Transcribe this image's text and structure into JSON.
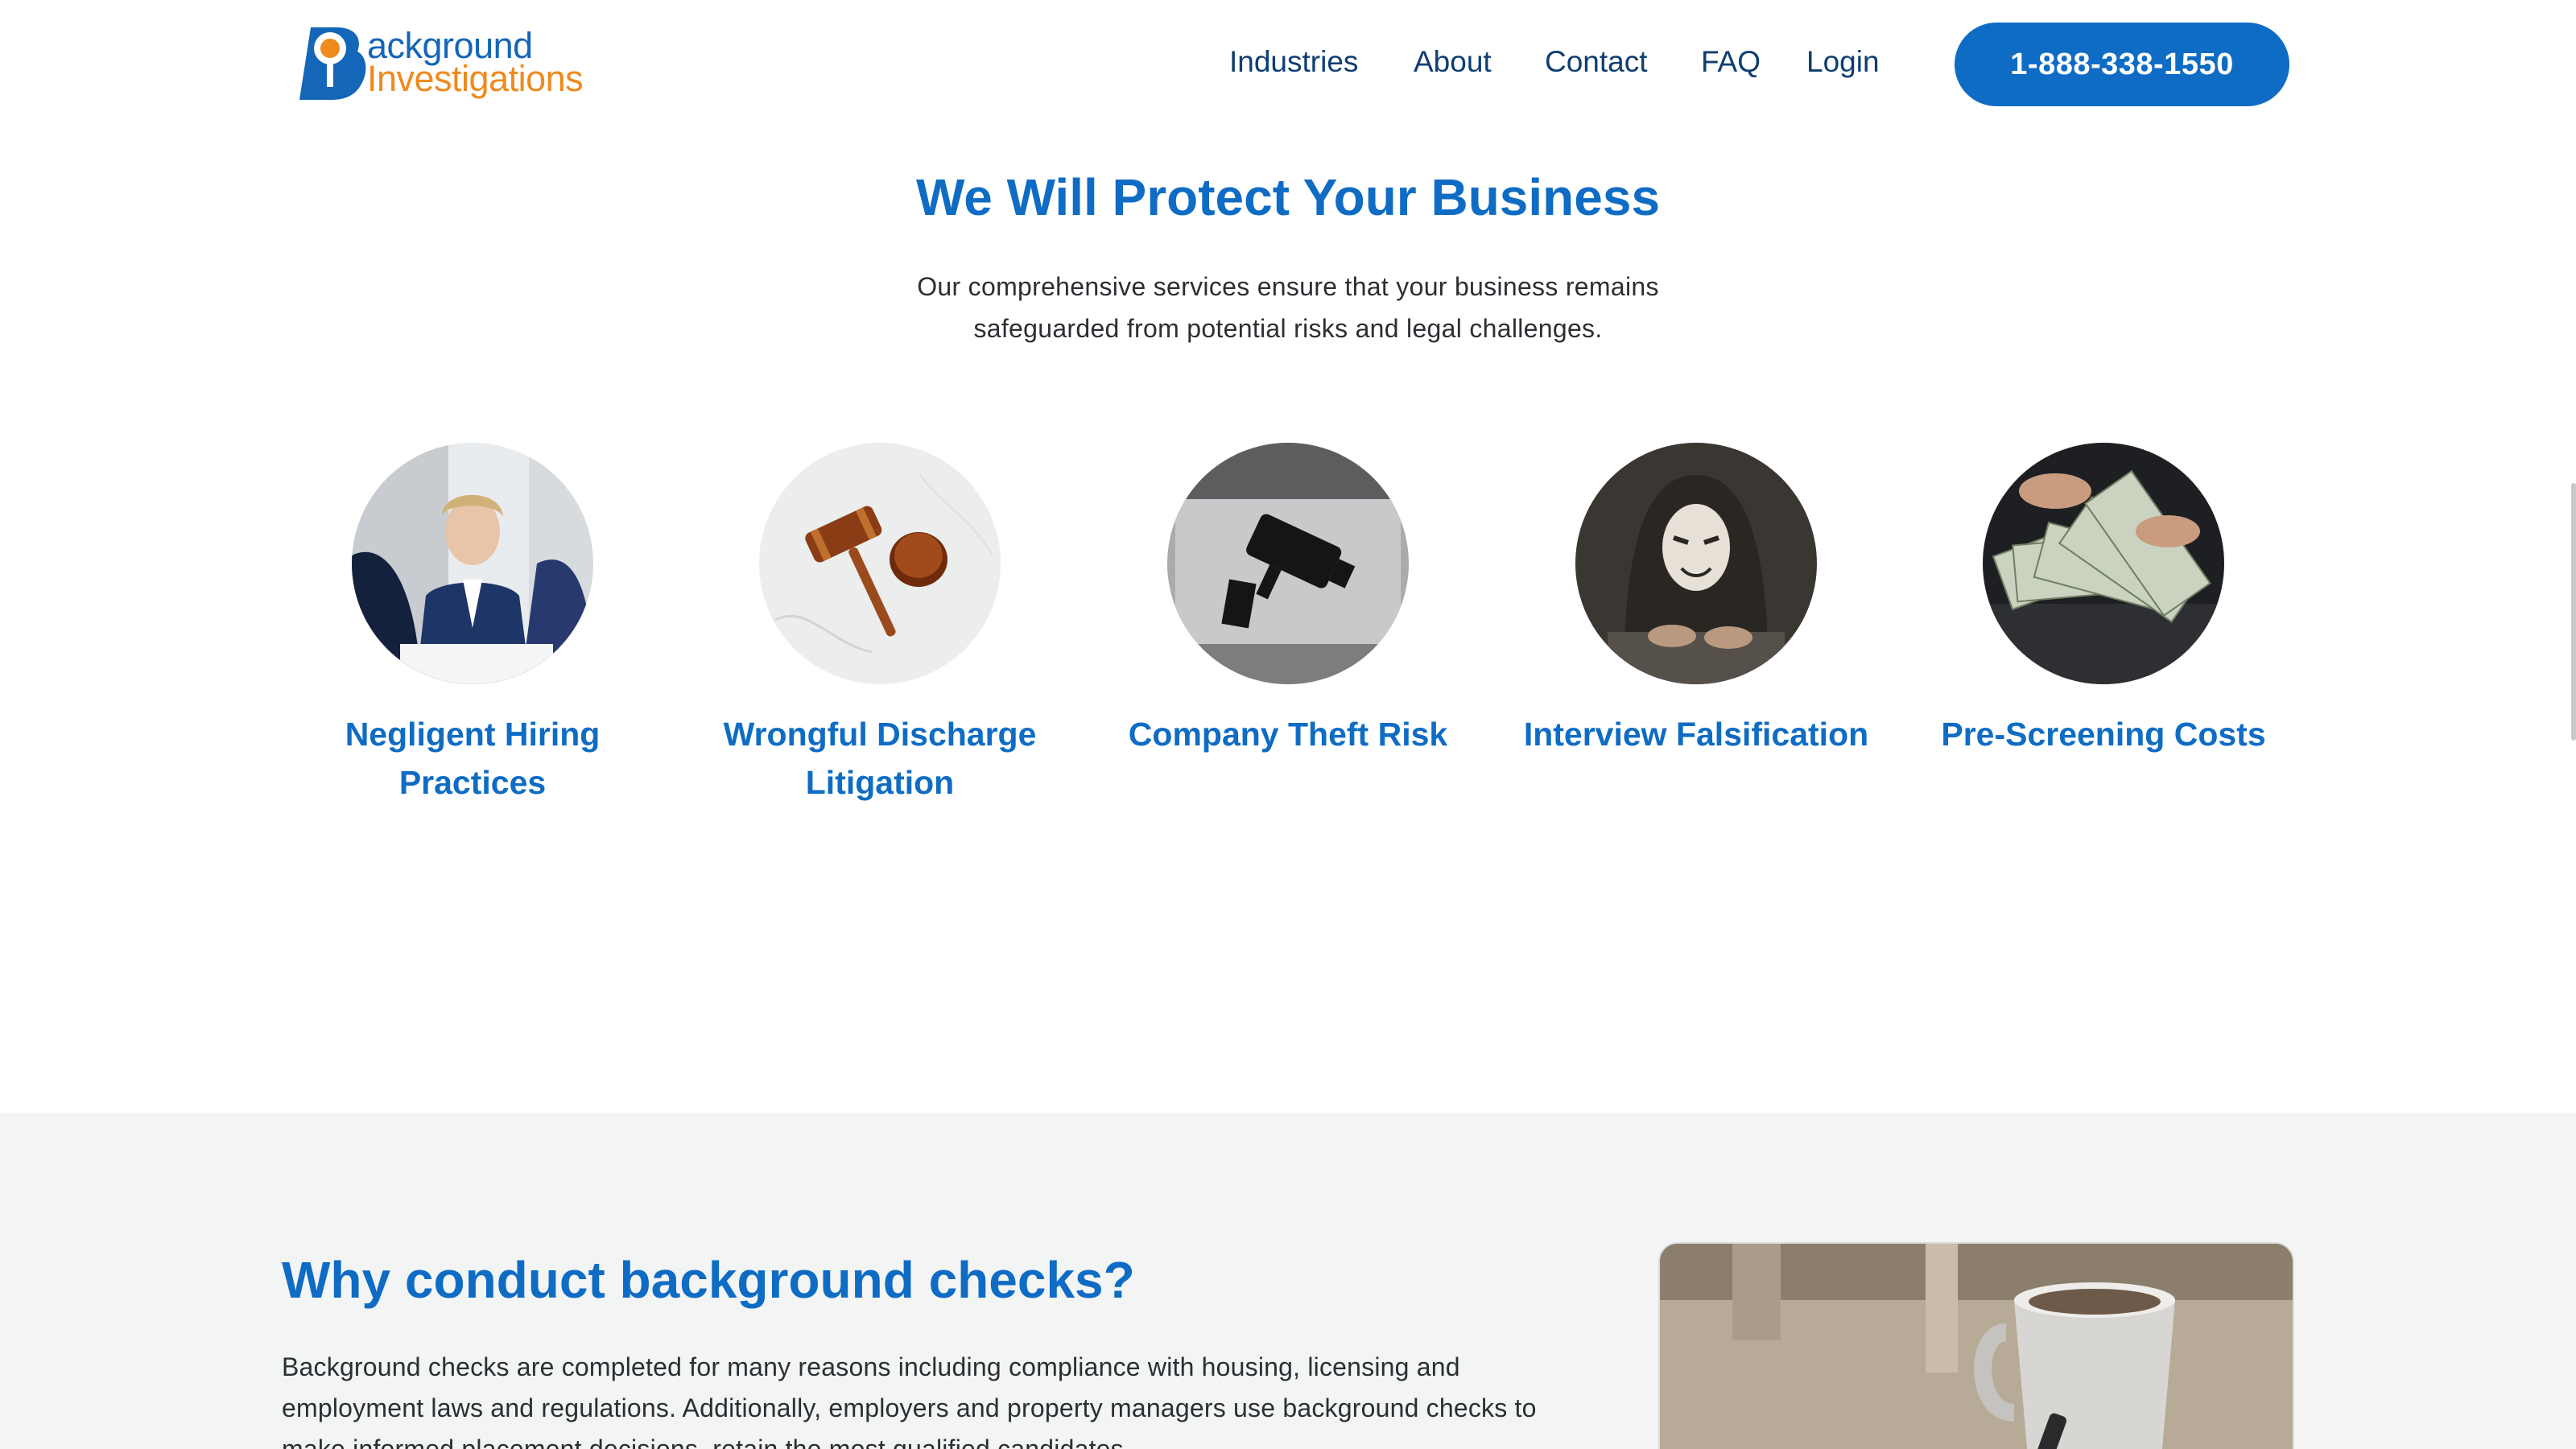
{
  "brand": {
    "line1": "ackground",
    "line2": "Investigations",
    "colors": {
      "blue": "#1466b8",
      "orange": "#ef8a1e"
    }
  },
  "nav": {
    "items": [
      {
        "label": "Industries"
      },
      {
        "label": "About"
      },
      {
        "label": "Contact"
      },
      {
        "label": "FAQ"
      },
      {
        "label": "Login"
      }
    ],
    "phone": "1-888-338-1550"
  },
  "protect": {
    "title": "We Will Protect Your Business",
    "subtitle": "Our comprehensive services ensure that your business remains safeguarded from potential risks and legal challenges.",
    "cards": [
      {
        "label": "Negligent Hiring Practices",
        "icon": "hiring-interview-photo"
      },
      {
        "label": "Wrongful Discharge Litigation",
        "icon": "gavel-photo"
      },
      {
        "label": "Company Theft Risk",
        "icon": "security-camera-photo"
      },
      {
        "label": "Interview Falsification",
        "icon": "masked-hacker-photo"
      },
      {
        "label": "Pre-Screening Costs",
        "icon": "money-cash-photo"
      }
    ]
  },
  "why": {
    "title": "Why conduct background checks?",
    "body": "Background checks are completed for many reasons including compliance with housing, licensing and employment laws and regulations. Additionally, employers and property managers use background checks to make informed placement decisions, retain the most qualified candidates"
  }
}
